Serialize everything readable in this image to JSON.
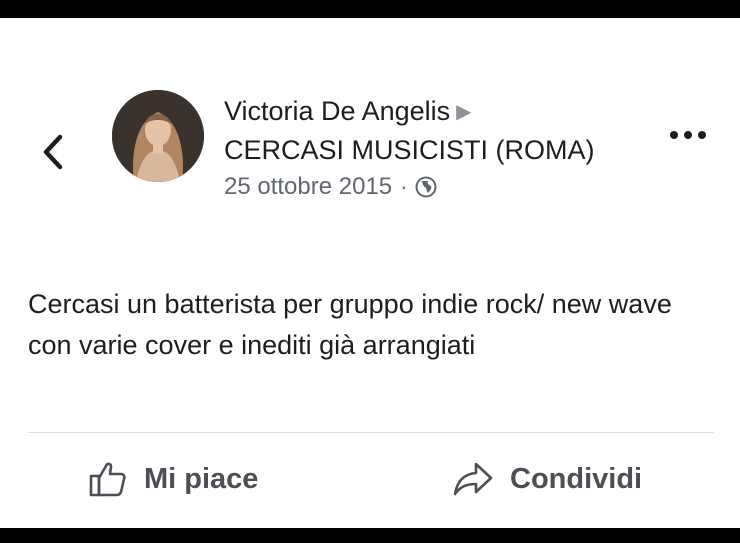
{
  "post": {
    "author": "Victoria De Angelis",
    "group": "CERCASI MUSICISTI (ROMA)",
    "date": "25 ottobre 2015",
    "separator": "·",
    "audience_icon": "globe-icon",
    "body": "Cercasi un batterista per gruppo indie rock/ new wave con varie cover e inediti già arrangiati"
  },
  "actions": {
    "like_label": "Mi piace",
    "share_label": "Condividi"
  },
  "icons": {
    "back": "chevron-left-icon",
    "more": "more-options-icon",
    "like": "thumbs-up-icon",
    "share": "share-arrow-icon"
  },
  "colors": {
    "text": "#1c1e21",
    "secondary": "#606770",
    "action": "#4b4f56",
    "divider": "#dadde1"
  }
}
